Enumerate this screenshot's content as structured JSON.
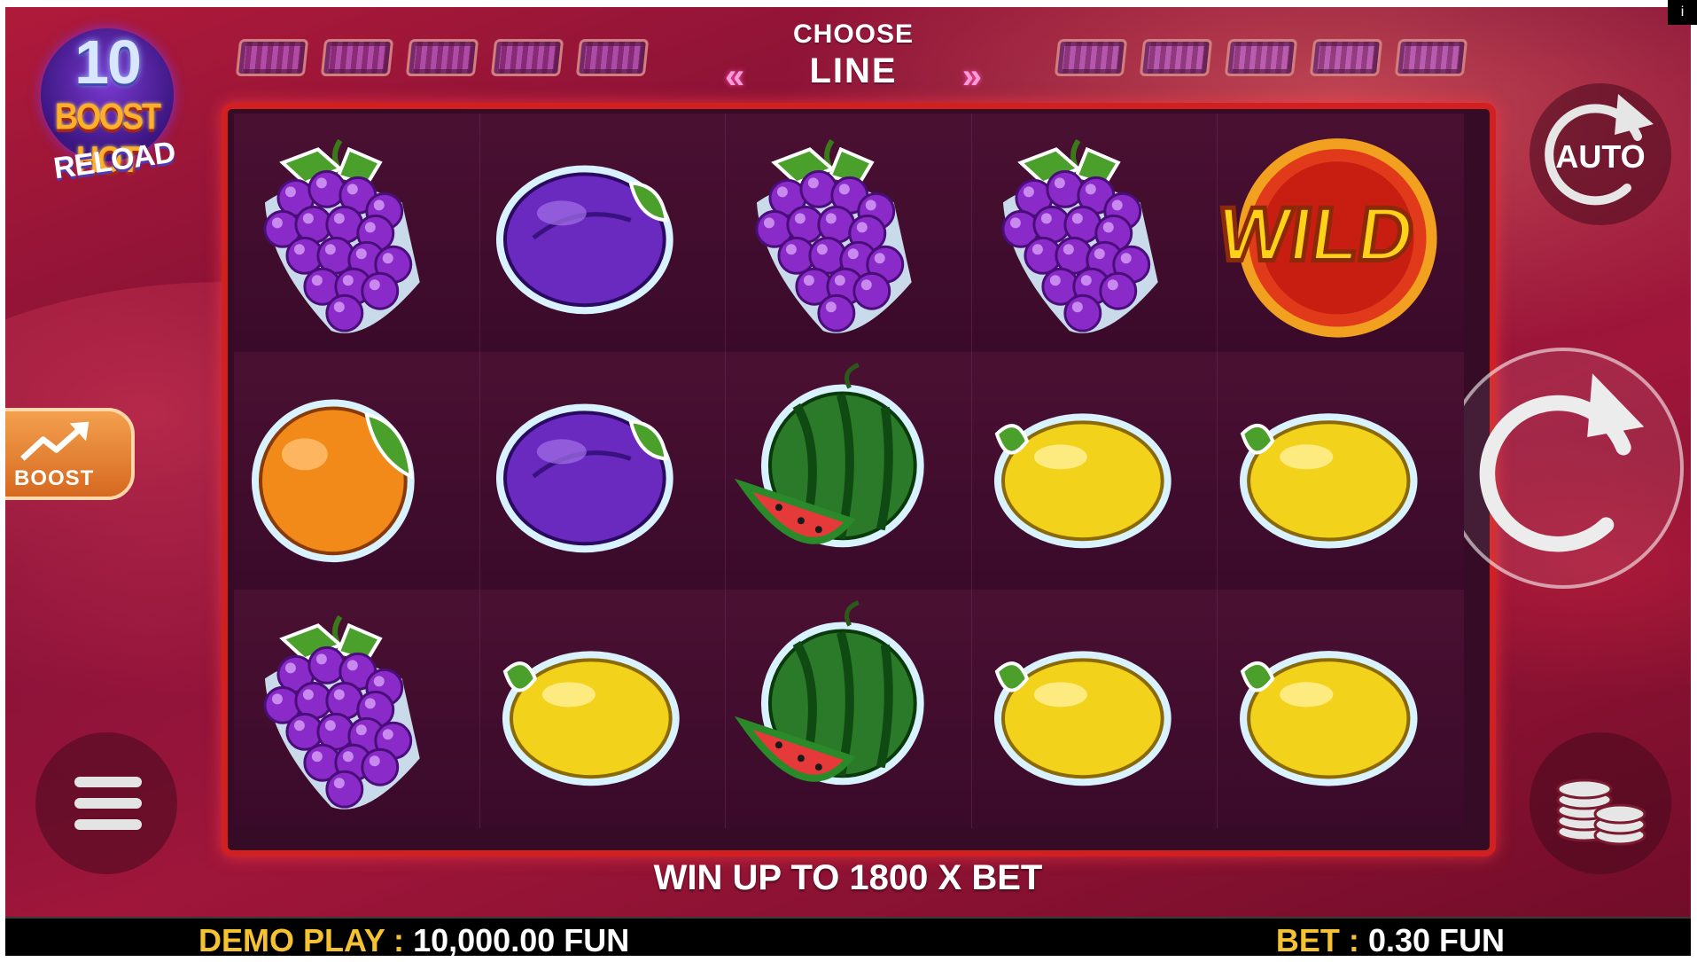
{
  "logo": {
    "number": "10",
    "line1": "BOOST HOT",
    "line2": "RELOAD"
  },
  "header": {
    "choose_label": "CHOOSE",
    "line_label": "LINE",
    "chevron_left": "«",
    "chevron_right": "»"
  },
  "lines_left_count": 5,
  "lines_right_count": 5,
  "reels": [
    [
      "grapes",
      "plum",
      "grapes",
      "grapes",
      "wild"
    ],
    [
      "orange",
      "plum",
      "watermelon",
      "lemon",
      "lemon"
    ],
    [
      "grapes",
      "lemon",
      "watermelon",
      "lemon",
      "lemon"
    ]
  ],
  "wild_text": "WILD",
  "buttons": {
    "auto_label": "AUTO",
    "boost_label": "BOOST",
    "info_label": "i"
  },
  "promo": "WIN UP TO 1800 X BET",
  "footer": {
    "demo_label": "DEMO PLAY :",
    "demo_value": "10,000.00 FUN",
    "bet_label": "BET :",
    "bet_value": "0.30 FUN"
  },
  "colors": {
    "frame": "#d21f1f",
    "accent_yellow": "#f6c232",
    "boost_orange": "#e8832f"
  }
}
